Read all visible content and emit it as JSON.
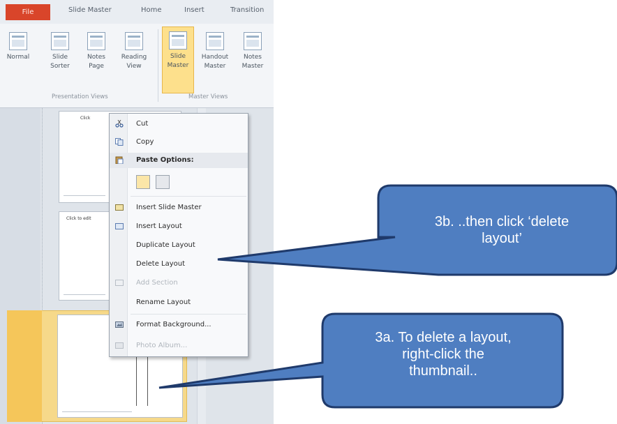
{
  "tabs": {
    "file": "File",
    "slide_master": "Slide Master",
    "home": "Home",
    "insert": "Insert",
    "transitions": "Transition"
  },
  "ribbon": {
    "buttons": [
      {
        "label": "Normal",
        "icon": "normal-view-icon"
      },
      {
        "label": "Slide Sorter",
        "icon": "slide-sorter-icon"
      },
      {
        "label": "Notes Page",
        "icon": "notes-page-icon"
      },
      {
        "label": "Reading View",
        "icon": "reading-view-icon"
      },
      {
        "label": "Slide Master",
        "icon": "slide-master-icon",
        "active": true
      },
      {
        "label": "Handout Master",
        "icon": "handout-master-icon"
      },
      {
        "label": "Notes Master",
        "icon": "notes-master-icon"
      }
    ],
    "groups": {
      "presentation_views": "Presentation Views",
      "master_views": "Master Views"
    }
  },
  "thumbnails": {
    "slide1_title": "Click",
    "slide2_title": "Click to edit"
  },
  "context_menu": {
    "items": [
      {
        "label": "Cut",
        "icon": "scissors-icon",
        "enabled": true
      },
      {
        "label": "Copy",
        "icon": "copy-icon",
        "enabled": true
      },
      {
        "label": "Paste Options:",
        "icon": "paste-icon",
        "heading": true
      },
      {
        "label": "Insert Slide Master",
        "icon": "insert-slide-master-icon",
        "enabled": true
      },
      {
        "label": "Insert Layout",
        "icon": "insert-layout-icon",
        "enabled": true
      },
      {
        "label": "Duplicate Layout",
        "enabled": true
      },
      {
        "label": "Delete Layout",
        "enabled": true
      },
      {
        "label": "Add Section",
        "icon": "section-icon",
        "enabled": false
      },
      {
        "label": "Rename Layout",
        "enabled": true
      },
      {
        "label": "Format Background...",
        "icon": "format-background-icon",
        "enabled": true
      },
      {
        "label": "Photo Album...",
        "icon": "photo-album-icon",
        "enabled": false
      }
    ]
  },
  "callouts": {
    "step_3b": "3b. ..then click ‘delete layout’",
    "step_3b_line1": "3b. ..then click ‘delete",
    "step_3b_line2": "layout’",
    "step_3a": "3a. To delete a layout, right-click the thumbnail..",
    "step_3a_line1": "3a. To delete a layout,",
    "step_3a_line2": "right-click the",
    "step_3a_line3": "thumbnail..",
    "fill_color": "#4f7ec1",
    "border_color": "#1f3a6b"
  },
  "colors": {
    "file_tab": "#d9452a",
    "active_button": "#fde08c",
    "selected_thumbnail": "#f5c65a"
  }
}
